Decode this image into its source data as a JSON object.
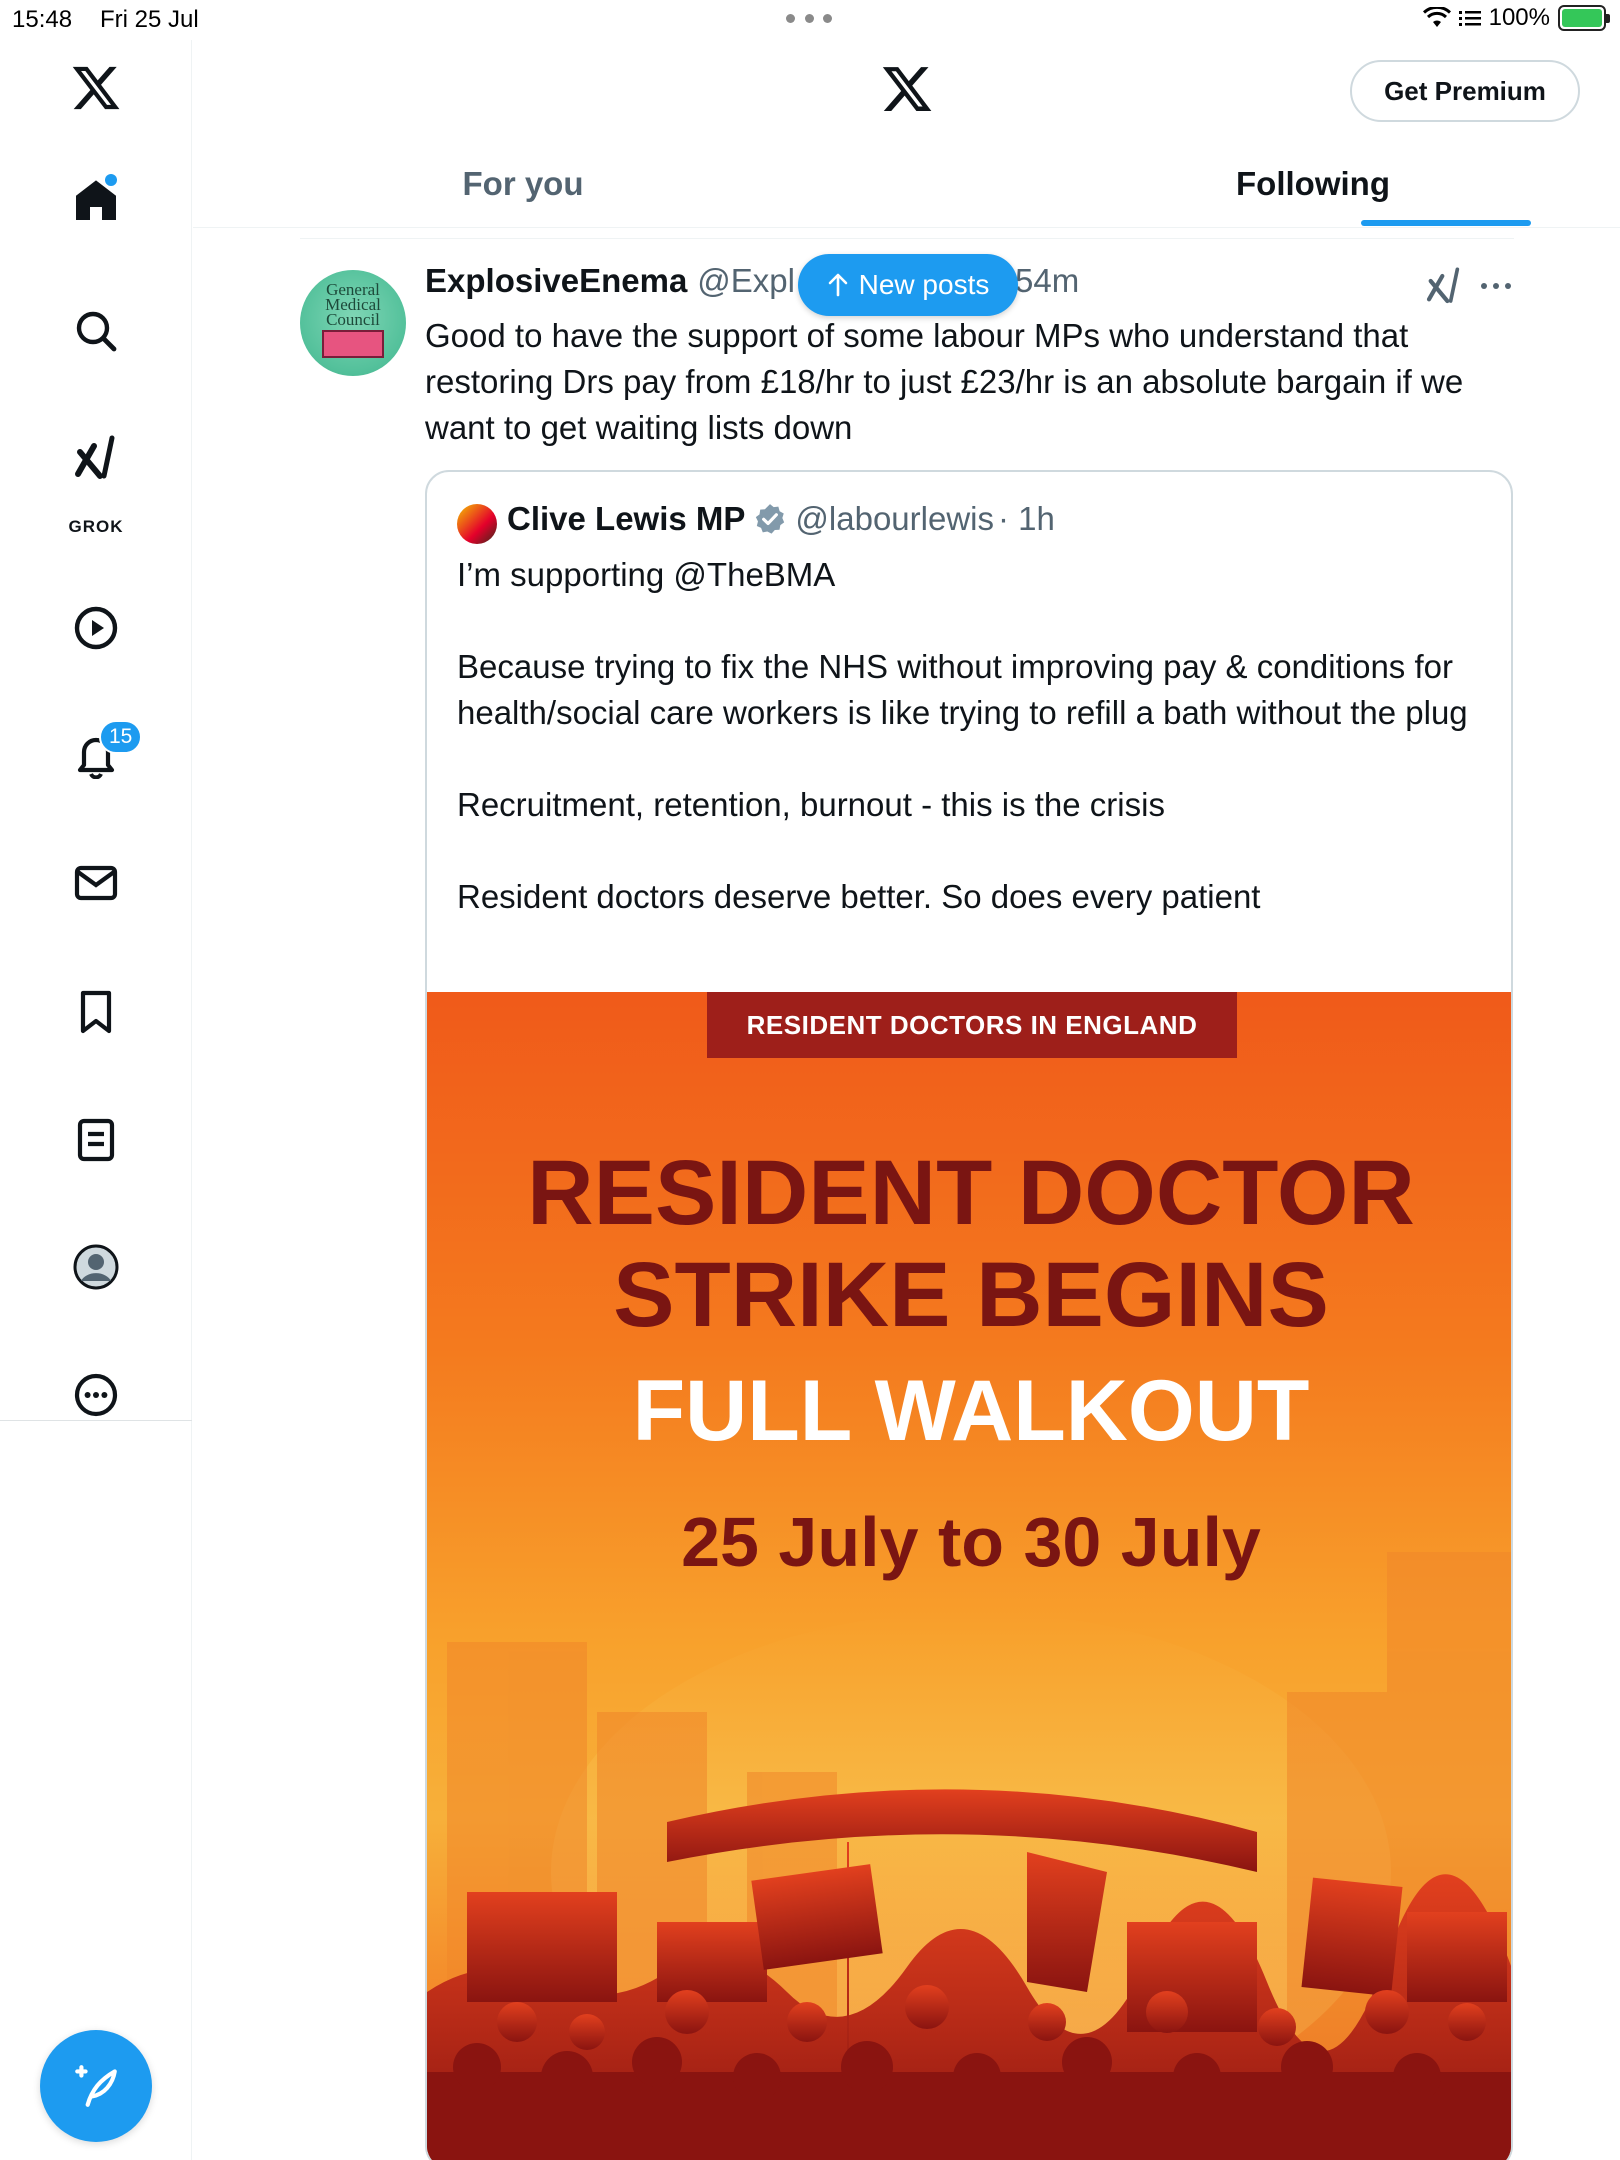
{
  "status_bar": {
    "time": "15:48",
    "date": "Fri 25 Jul",
    "battery": "100%"
  },
  "sidebar": {
    "grok_label": "GROK",
    "notifications_count": "15",
    "items": [
      "home",
      "search",
      "grok",
      "video",
      "notifications",
      "messages",
      "bookmarks",
      "lists",
      "profile",
      "more"
    ]
  },
  "header": {
    "premium_label": "Get Premium",
    "tabs": [
      {
        "label": "For you",
        "active": false
      },
      {
        "label": "Following",
        "active": true
      }
    ]
  },
  "new_posts_label": "New posts",
  "tweet": {
    "author_name": "ExplosiveEnema",
    "author_handle": "@Expl",
    "time": "54m",
    "avatar_text": "General Medical Council",
    "body": "Good to have the support of some labour MPs who understand that restoring Drs pay from £18/hr to just £23/hr is an absolute bargain if we want to get waiting lists down",
    "quote": {
      "author_name": "Clive Lewis MP",
      "author_handle": "@labourlewis",
      "time": "· 1h",
      "text": "I’m supporting @TheBMA\n\nBecause trying to fix the NHS without improving pay & conditions for health/social care workers is like trying to refill a bath without the plug\n\nRecruitment, retention, burnout - this is the crisis\n\nResident doctors deserve better. So does every patient",
      "image": {
        "banner": "RESIDENT DOCTORS IN ENGLAND",
        "title_line1": "RESIDENT DOCTOR",
        "title_line2": "STRIKE BEGINS",
        "subtitle": "FULL WALKOUT",
        "dates": "25 July to 30 July"
      }
    }
  },
  "colors": {
    "accent": "#1d9bf0",
    "text": "#0f1419",
    "muted": "#536471",
    "poster_red": "#7a1512",
    "poster_banner": "#9e1f1a"
  }
}
